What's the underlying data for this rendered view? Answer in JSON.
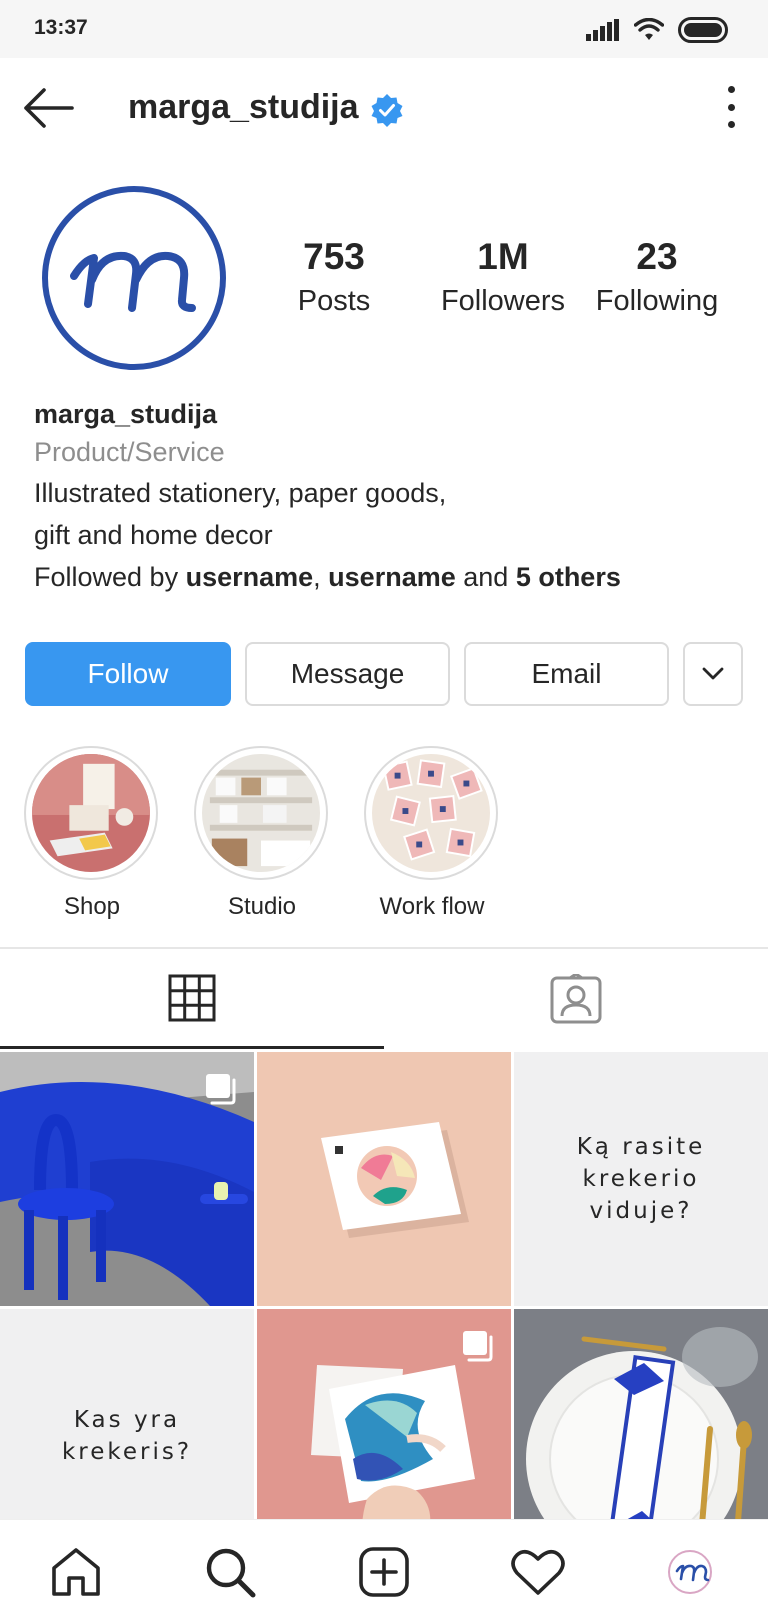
{
  "status_bar": {
    "time": "13:37"
  },
  "header": {
    "username": "marga_studija",
    "verified": true
  },
  "stats": [
    {
      "value": "753",
      "label": "Posts"
    },
    {
      "value": "1M",
      "label": "Followers"
    },
    {
      "value": "23",
      "label": "Following"
    }
  ],
  "bio": {
    "name": "marga_studija",
    "category": "Product/Service",
    "line1": "Illustrated stationery, paper goods,",
    "line2": "gift and home decor",
    "followed_prefix": "Followed by ",
    "followed_user1": "username",
    "followed_sep": ", ",
    "followed_user2": "username",
    "followed_and": " and ",
    "followed_others": "5 others"
  },
  "actions": {
    "follow": "Follow",
    "message": "Message",
    "email": "Email"
  },
  "highlights": [
    {
      "label": "Shop"
    },
    {
      "label": "Studio"
    },
    {
      "label": "Work flow"
    }
  ],
  "tabs": [
    {
      "icon": "grid-icon",
      "active": true
    },
    {
      "icon": "tagged-icon",
      "active": false
    }
  ],
  "posts": [
    {
      "kind": "image",
      "multi": true
    },
    {
      "kind": "image",
      "multi": false
    },
    {
      "kind": "text",
      "text": "Ką rasite\nkrekerio\nviduje?"
    },
    {
      "kind": "text",
      "text": "Kas yra\nkrekeris?"
    },
    {
      "kind": "image",
      "multi": true
    },
    {
      "kind": "image",
      "multi": false
    }
  ],
  "bottom_nav": [
    {
      "icon": "home-icon"
    },
    {
      "icon": "search-icon"
    },
    {
      "icon": "new-post-icon"
    },
    {
      "icon": "activity-heart-icon"
    },
    {
      "icon": "profile-avatar-icon"
    }
  ],
  "colors": {
    "brand_blue": "#2a4fa8",
    "follow_button": "#3897f0",
    "verified_badge": "#3897f0"
  }
}
